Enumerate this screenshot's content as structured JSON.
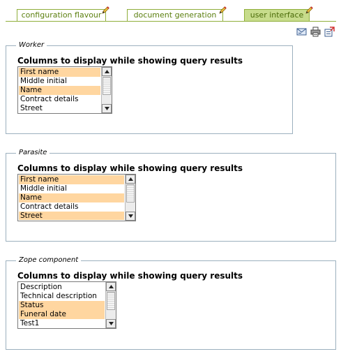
{
  "tabs": [
    {
      "label": "configuration flavour",
      "active": false
    },
    {
      "label": "document generation",
      "active": false
    },
    {
      "label": "user interface",
      "active": true
    }
  ],
  "actions": [
    {
      "icon": "send-mail-icon"
    },
    {
      "icon": "print-icon"
    },
    {
      "icon": "export-icon"
    }
  ],
  "sections": [
    {
      "legend": "Worker",
      "title": "Columns to display while showing query results",
      "options": [
        {
          "label": "First name",
          "selected": true
        },
        {
          "label": "Middle initial",
          "selected": false
        },
        {
          "label": "Name",
          "selected": true
        },
        {
          "label": "Contract details",
          "selected": false
        },
        {
          "label": "Street",
          "selected": false
        }
      ]
    },
    {
      "legend": "Parasite",
      "title": "Columns to display while showing query results",
      "options": [
        {
          "label": "First name",
          "selected": true
        },
        {
          "label": "Middle initial",
          "selected": false
        },
        {
          "label": "Name",
          "selected": true
        },
        {
          "label": "Contract details",
          "selected": false
        },
        {
          "label": "Street",
          "selected": true
        }
      ]
    },
    {
      "legend": "Zope component",
      "title": "Columns to display while showing query results",
      "options": [
        {
          "label": "Description",
          "selected": false
        },
        {
          "label": "Technical description",
          "selected": false
        },
        {
          "label": "Status",
          "selected": true
        },
        {
          "label": "Funeral date",
          "selected": true
        },
        {
          "label": "Test1",
          "selected": false
        }
      ]
    }
  ],
  "colors": {
    "tab_border": "#8fae3a",
    "tab_active_bg": "#c7dc8c",
    "tab_text": "#5b7f0f",
    "fieldset_border": "#9cb0be",
    "selected_option_bg": "#ffd6a0"
  }
}
